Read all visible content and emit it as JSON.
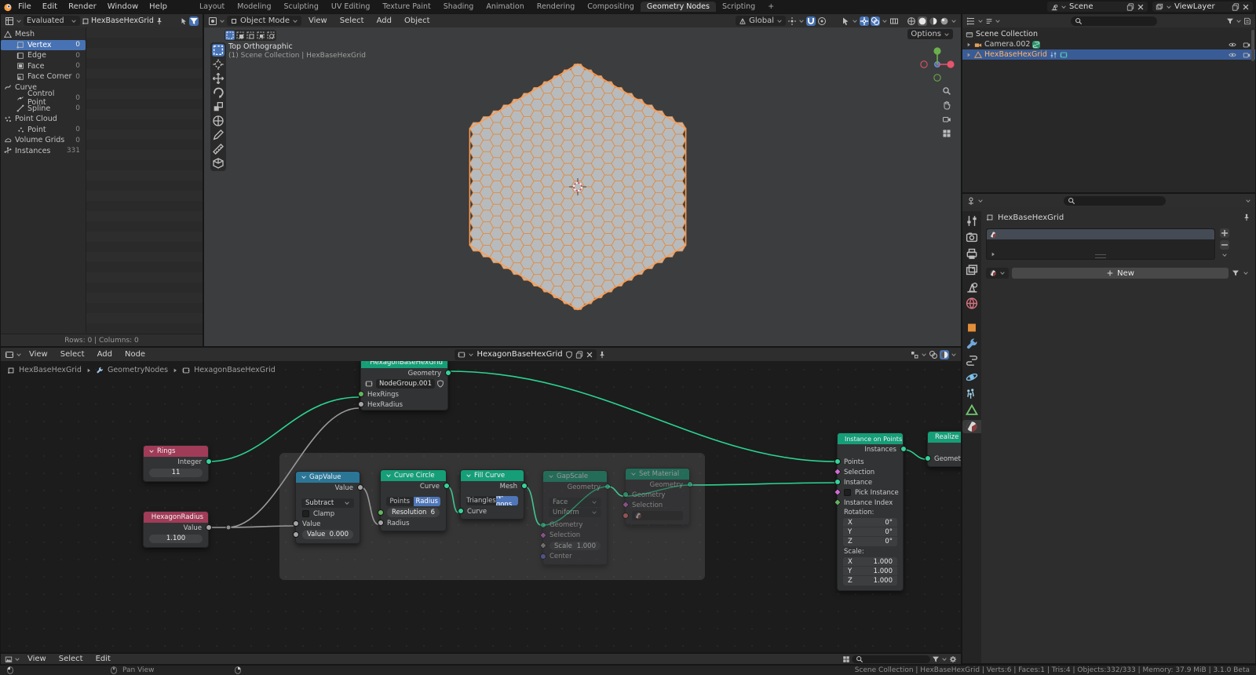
{
  "topbar": {
    "menus": [
      "File",
      "Edit",
      "Render",
      "Window",
      "Help"
    ],
    "tabs": [
      "Layout",
      "Modeling",
      "Sculpting",
      "UV Editing",
      "Texture Paint",
      "Shading",
      "Animation",
      "Rendering",
      "Compositing",
      "Geometry Nodes",
      "Scripting"
    ],
    "add_tab": "+",
    "scene": "Scene",
    "view_layer": "ViewLayer"
  },
  "spreadsheet": {
    "evaluated": "Evaluated",
    "object_name": "HexBaseHexGrid",
    "rows": [
      {
        "label": "Mesh",
        "count": ""
      },
      {
        "label": "Vertex",
        "count": "0"
      },
      {
        "label": "Edge",
        "count": "0"
      },
      {
        "label": "Face",
        "count": "0"
      },
      {
        "label": "Face Corner",
        "count": "0"
      },
      {
        "label": "Curve",
        "count": ""
      },
      {
        "label": "Control Point",
        "count": "0"
      },
      {
        "label": "Spline",
        "count": "0"
      },
      {
        "label": "Point Cloud",
        "count": ""
      },
      {
        "label": "Point",
        "count": "0"
      },
      {
        "label": "Volume Grids",
        "count": "0"
      },
      {
        "label": "Instances",
        "count": "331"
      }
    ],
    "footer": "Rows: 0   |   Columns: 0"
  },
  "viewport": {
    "mode": "Object Mode",
    "menus": [
      "View",
      "Select",
      "Add",
      "Object"
    ],
    "orientation": "Global",
    "options": "Options",
    "overlay_title": "Top Orthographic",
    "overlay_subtitle": "(1) Scene Collection | HexBaseHexGrid"
  },
  "outliner": {
    "root": "Scene Collection",
    "items": [
      {
        "name": "Camera.002"
      },
      {
        "name": "HexBaseHexGrid"
      }
    ]
  },
  "properties": {
    "object_name": "HexBaseHexGrid",
    "new_button": "New"
  },
  "node_editor": {
    "menus": [
      "View",
      "Select",
      "Add",
      "Node"
    ],
    "tree_name": "HexagonBaseHexGrid",
    "breadcrumb": [
      "HexBaseHexGrid",
      "GeometryNodes",
      "HexagonBaseHexGrid"
    ],
    "nodes": {
      "group": {
        "title": "HexagonBaseHexGrid",
        "output": "Geometry",
        "group_field": "NodeGroup.001",
        "input_rings": "HexRings",
        "input_radius": "HexRadius"
      },
      "rings": {
        "title": "Rings",
        "output": "Integer",
        "value": "11"
      },
      "hex_radius": {
        "title": "HexagonRadius",
        "output": "Value",
        "value": "1.100"
      },
      "gap_value": {
        "title": "GapValue",
        "output": "Value",
        "operation": "Subtract",
        "clamp": "Clamp",
        "input": "Value",
        "value_label": "Value",
        "value": "0.000"
      },
      "curve_circle": {
        "title": "Curve Circle",
        "output": "Curve",
        "mode_points": "Points",
        "mode_radius": "Radius",
        "resolution_label": "Resolution",
        "resolution": "6",
        "input": "Radius"
      },
      "fill_curve": {
        "title": "Fill Curve",
        "output": "Mesh",
        "mode_triangles": "Triangles",
        "mode_ngons": "N-gons",
        "input": "Curve"
      },
      "gap_scale": {
        "title": "GapScale",
        "output": "Geometry",
        "domain": "Face",
        "mode": "Uniform",
        "input_geometry": "Geometry",
        "input_selection": "Selection",
        "scale_label": "Scale",
        "scale": "1.000",
        "center": "Center"
      },
      "set_material": {
        "title": "Set Material",
        "output": "Geometry",
        "input_geometry": "Geometry",
        "input_selection": "Selection"
      },
      "instance_on_points": {
        "title": "Instance on Points",
        "output": "Instances",
        "in_points": "Points",
        "in_selection": "Selection",
        "in_instance": "Instance",
        "in_pick": "Pick Instance",
        "in_index": "Instance Index",
        "rotation_label": "Rotation:",
        "rx_l": "X",
        "rx": "0°",
        "ry_l": "Y",
        "ry": "0°",
        "rz_l": "Z",
        "rz": "0°",
        "scale_label": "Scale:",
        "sx_l": "X",
        "sx": "1.000",
        "sy_l": "Y",
        "sy": "1.000",
        "sz_l": "Z",
        "sz": "1.000"
      },
      "realize": {
        "title": "Realize Instances",
        "input": "Geometry"
      }
    }
  },
  "bottom_editor": {
    "menus": [
      "View",
      "Select",
      "Edit"
    ]
  },
  "status_bar": {
    "pan_hint": "Pan View",
    "info": "Scene Collection | HexBaseHexGrid | Verts:6 | Faces:1 | Tris:4 | Objects:332/333 | Memory: 37.9 MiB | 3.1.0 Beta"
  },
  "scene_stats": {
    "instances": 331,
    "rings": 11
  },
  "colors": {
    "selection_blue": "#4772b3",
    "node_green": "#159e78",
    "node_red": "#a03b58",
    "node_blue": "#2b7697",
    "wire_green": "#2bd492",
    "wire_gray": "#9a9a9a",
    "hex_fill": "#b8bbbd",
    "hex_stroke": "#dd8e49",
    "hex_outline": "#ff9a4d"
  }
}
